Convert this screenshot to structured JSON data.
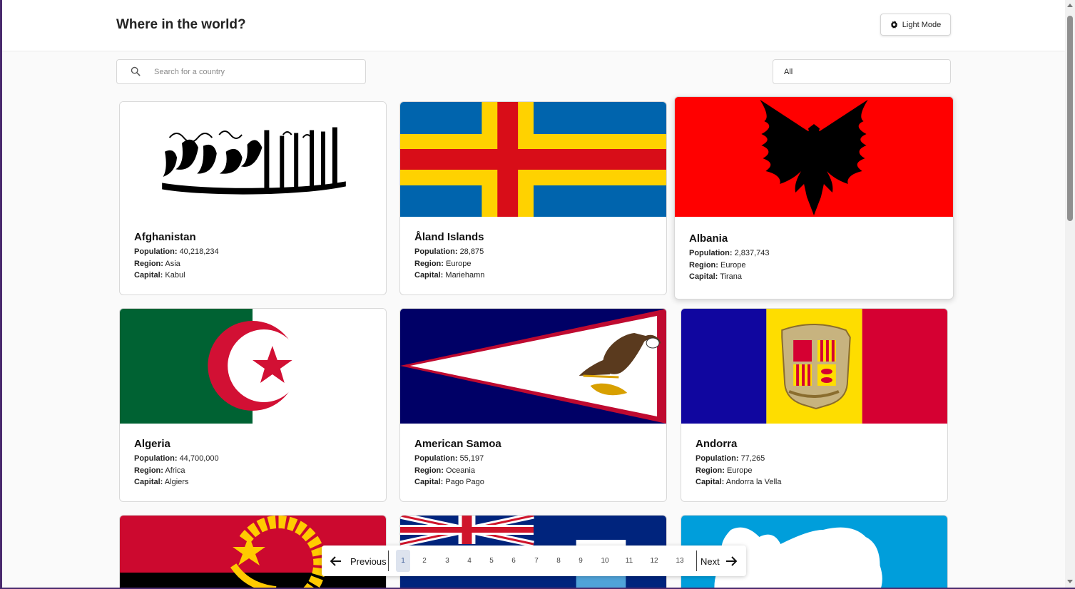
{
  "header": {
    "title": "Where in the world?",
    "mode_button_label": "Light Mode",
    "mode_icon": "gear-icon"
  },
  "filters": {
    "search_placeholder": "Search for a country",
    "search_icon": "search-icon",
    "region_selected": "All"
  },
  "labels": {
    "population": "Population:",
    "region": "Region:",
    "capital": "Capital:"
  },
  "countries": [
    {
      "name": "Afghanistan",
      "population": "40,218,234",
      "region": "Asia",
      "capital": "Kabul",
      "flag": "afghanistan-flag"
    },
    {
      "name": "Åland Islands",
      "population": "28,875",
      "region": "Europe",
      "capital": "Mariehamn",
      "flag": "aland-islands-flag"
    },
    {
      "name": "Albania",
      "population": "2,837,743",
      "region": "Europe",
      "capital": "Tirana",
      "flag": "albania-flag"
    },
    {
      "name": "Algeria",
      "population": "44,700,000",
      "region": "Africa",
      "capital": "Algiers",
      "flag": "algeria-flag"
    },
    {
      "name": "American Samoa",
      "population": "55,197",
      "region": "Oceania",
      "capital": "Pago Pago",
      "flag": "american-samoa-flag"
    },
    {
      "name": "Andorra",
      "population": "77,265",
      "region": "Europe",
      "capital": "Andorra la Vella",
      "flag": "andorra-flag"
    }
  ],
  "partial_flags": [
    "angola-flag",
    "anguilla-flag",
    "antarctica-flag"
  ],
  "pagination": {
    "previous_label": "Previous",
    "next_label": "Next",
    "pages": [
      "1",
      "2",
      "3",
      "4",
      "5",
      "6",
      "7",
      "8",
      "9",
      "10",
      "11",
      "12",
      "13"
    ],
    "current_page": "1"
  },
  "colors": {
    "background": "#fafafa",
    "card": "#ffffff",
    "text": "#111517",
    "active_page_bg": "#dde3ee"
  }
}
